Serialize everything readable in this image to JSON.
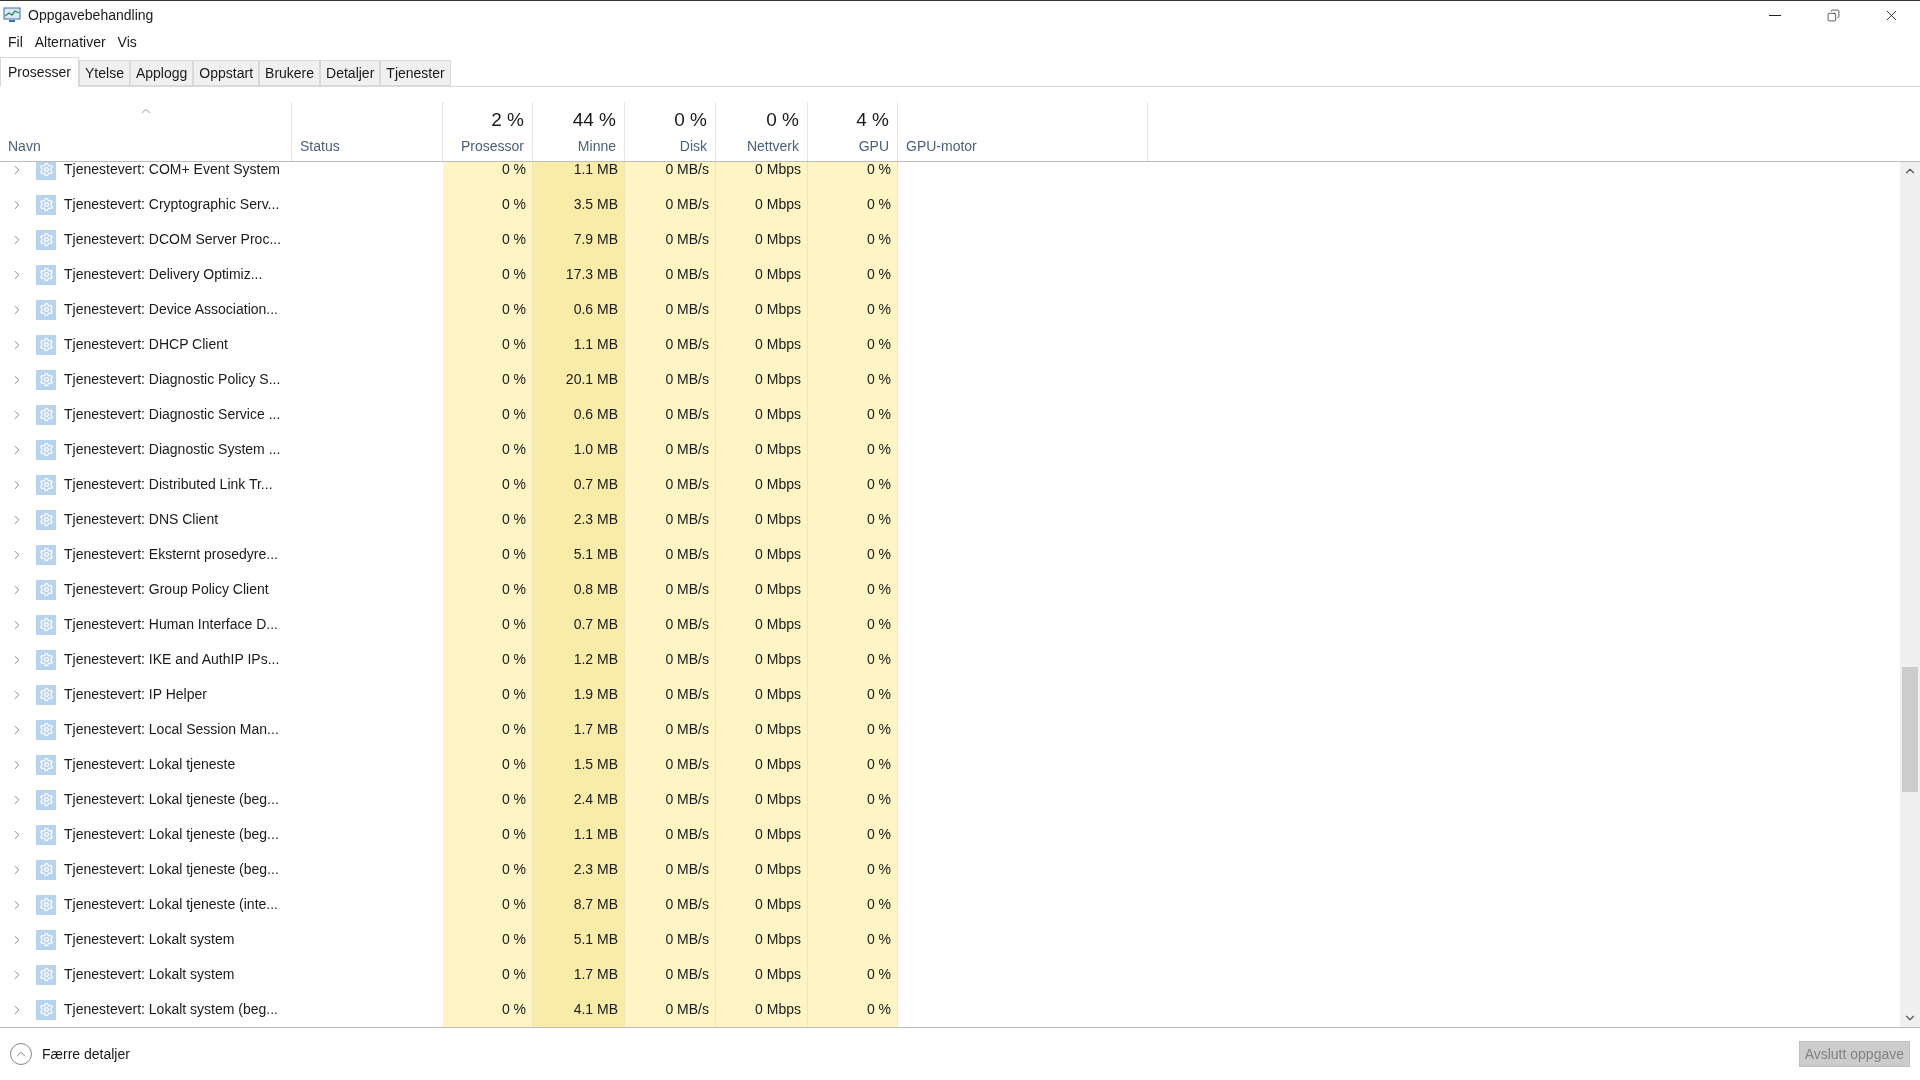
{
  "window": {
    "title": "Oppgavebehandling"
  },
  "menu": [
    "Fil",
    "Alternativer",
    "Vis"
  ],
  "tabs": [
    {
      "label": "Prosesser",
      "selected": true
    },
    {
      "label": "Ytelse",
      "selected": false
    },
    {
      "label": "Applogg",
      "selected": false
    },
    {
      "label": "Oppstart",
      "selected": false
    },
    {
      "label": "Brukere",
      "selected": false
    },
    {
      "label": "Detaljer",
      "selected": false
    },
    {
      "label": "Tjenester",
      "selected": false
    }
  ],
  "columns": [
    {
      "label": "Navn",
      "sorted": true
    },
    {
      "label": "Status",
      "sorted": false
    },
    {
      "label": "Prosessor",
      "usage": "2 %",
      "sorted": false
    },
    {
      "label": "Minne",
      "usage": "44 %",
      "sorted": false
    },
    {
      "label": "Disk",
      "usage": "0 %",
      "sorted": false
    },
    {
      "label": "Nettverk",
      "usage": "0 %",
      "sorted": false
    },
    {
      "label": "GPU",
      "usage": "4 %",
      "sorted": false
    },
    {
      "label": "GPU-motor",
      "sorted": false
    }
  ],
  "rows": [
    {
      "name": "Tjenestevert: COM+ Event System",
      "cpu": "0 %",
      "memory": "1.1 MB",
      "disk": "0 MB/s",
      "network": "0 Mbps",
      "gpu": "0 %"
    },
    {
      "name": "Tjenestevert: Cryptographic Serv...",
      "cpu": "0 %",
      "memory": "3.5 MB",
      "disk": "0 MB/s",
      "network": "0 Mbps",
      "gpu": "0 %"
    },
    {
      "name": "Tjenestevert: DCOM Server Proc...",
      "cpu": "0 %",
      "memory": "7.9 MB",
      "disk": "0 MB/s",
      "network": "0 Mbps",
      "gpu": "0 %"
    },
    {
      "name": "Tjenestevert: Delivery Optimiz...",
      "cpu": "0 %",
      "memory": "17.3 MB",
      "disk": "0 MB/s",
      "network": "0 Mbps",
      "gpu": "0 %"
    },
    {
      "name": "Tjenestevert: Device Association...",
      "cpu": "0 %",
      "memory": "0.6 MB",
      "disk": "0 MB/s",
      "network": "0 Mbps",
      "gpu": "0 %"
    },
    {
      "name": "Tjenestevert: DHCP Client",
      "cpu": "0 %",
      "memory": "1.1 MB",
      "disk": "0 MB/s",
      "network": "0 Mbps",
      "gpu": "0 %"
    },
    {
      "name": "Tjenestevert: Diagnostic Policy S...",
      "cpu": "0 %",
      "memory": "20.1 MB",
      "disk": "0 MB/s",
      "network": "0 Mbps",
      "gpu": "0 %"
    },
    {
      "name": "Tjenestevert: Diagnostic Service ...",
      "cpu": "0 %",
      "memory": "0.6 MB",
      "disk": "0 MB/s",
      "network": "0 Mbps",
      "gpu": "0 %"
    },
    {
      "name": "Tjenestevert: Diagnostic System ...",
      "cpu": "0 %",
      "memory": "1.0 MB",
      "disk": "0 MB/s",
      "network": "0 Mbps",
      "gpu": "0 %"
    },
    {
      "name": "Tjenestevert: Distributed Link Tr...",
      "cpu": "0 %",
      "memory": "0.7 MB",
      "disk": "0 MB/s",
      "network": "0 Mbps",
      "gpu": "0 %"
    },
    {
      "name": "Tjenestevert: DNS Client",
      "cpu": "0 %",
      "memory": "2.3 MB",
      "disk": "0 MB/s",
      "network": "0 Mbps",
      "gpu": "0 %"
    },
    {
      "name": "Tjenestevert: Eksternt prosedyre...",
      "cpu": "0 %",
      "memory": "5.1 MB",
      "disk": "0 MB/s",
      "network": "0 Mbps",
      "gpu": "0 %"
    },
    {
      "name": "Tjenestevert: Group Policy Client",
      "cpu": "0 %",
      "memory": "0.8 MB",
      "disk": "0 MB/s",
      "network": "0 Mbps",
      "gpu": "0 %"
    },
    {
      "name": "Tjenestevert: Human Interface D...",
      "cpu": "0 %",
      "memory": "0.7 MB",
      "disk": "0 MB/s",
      "network": "0 Mbps",
      "gpu": "0 %"
    },
    {
      "name": "Tjenestevert: IKE and AuthIP IPs...",
      "cpu": "0 %",
      "memory": "1.2 MB",
      "disk": "0 MB/s",
      "network": "0 Mbps",
      "gpu": "0 %"
    },
    {
      "name": "Tjenestevert: IP Helper",
      "cpu": "0 %",
      "memory": "1.9 MB",
      "disk": "0 MB/s",
      "network": "0 Mbps",
      "gpu": "0 %"
    },
    {
      "name": "Tjenestevert: Local Session Man...",
      "cpu": "0 %",
      "memory": "1.7 MB",
      "disk": "0 MB/s",
      "network": "0 Mbps",
      "gpu": "0 %"
    },
    {
      "name": "Tjenestevert: Lokal tjeneste",
      "cpu": "0 %",
      "memory": "1.5 MB",
      "disk": "0 MB/s",
      "network": "0 Mbps",
      "gpu": "0 %"
    },
    {
      "name": "Tjenestevert: Lokal tjeneste (beg...",
      "cpu": "0 %",
      "memory": "2.4 MB",
      "disk": "0 MB/s",
      "network": "0 Mbps",
      "gpu": "0 %"
    },
    {
      "name": "Tjenestevert: Lokal tjeneste (beg...",
      "cpu": "0 %",
      "memory": "1.1 MB",
      "disk": "0 MB/s",
      "network": "0 Mbps",
      "gpu": "0 %"
    },
    {
      "name": "Tjenestevert: Lokal tjeneste (beg...",
      "cpu": "0 %",
      "memory": "2.3 MB",
      "disk": "0 MB/s",
      "network": "0 Mbps",
      "gpu": "0 %"
    },
    {
      "name": "Tjenestevert: Lokal tjeneste (inte...",
      "cpu": "0 %",
      "memory": "8.7 MB",
      "disk": "0 MB/s",
      "network": "0 Mbps",
      "gpu": "0 %"
    },
    {
      "name": "Tjenestevert: Lokalt system",
      "cpu": "0 %",
      "memory": "5.1 MB",
      "disk": "0 MB/s",
      "network": "0 Mbps",
      "gpu": "0 %"
    },
    {
      "name": "Tjenestevert: Lokalt system",
      "cpu": "0 %",
      "memory": "1.7 MB",
      "disk": "0 MB/s",
      "network": "0 Mbps",
      "gpu": "0 %"
    },
    {
      "name": "Tjenestevert: Lokalt system (beg...",
      "cpu": "0 %",
      "memory": "4.1 MB",
      "disk": "0 MB/s",
      "network": "0 Mbps",
      "gpu": "0 %"
    }
  ],
  "footer": {
    "toggle": "Færre detaljer",
    "end_task": {
      "label": "Avslutt oppgave",
      "disabled": true
    }
  }
}
